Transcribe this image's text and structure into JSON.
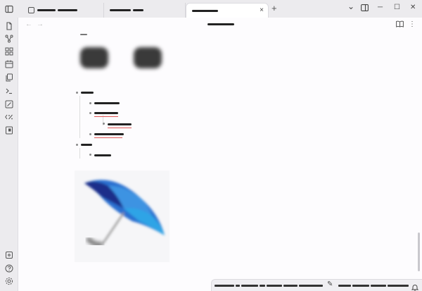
{
  "tabs": [
    {
      "label": "",
      "active": false,
      "close": ""
    },
    {
      "label": "",
      "active": false,
      "close": ""
    },
    {
      "label": "",
      "active": true,
      "close": "×"
    }
  ],
  "tabbar": {
    "new_tab": "+",
    "chevron": "⌄",
    "minimize": "─",
    "maximize": "☐",
    "close": "✕"
  },
  "ribbon": {
    "items": [
      "sidebar-toggle-icon",
      "files-icon",
      "graph-icon",
      "canvas-icon",
      "calendar-icon",
      "copy-icon",
      "terminal-icon",
      "sliders-icon",
      "code-percent-icon",
      "book-icon"
    ],
    "bottom": [
      "vault-icon",
      "help-icon",
      "settings-icon"
    ]
  },
  "nav": {
    "back": "←",
    "forward": "→"
  },
  "view": {
    "title": "",
    "reading": "📖",
    "more": "⋮"
  },
  "status": {
    "pencil": "✎",
    "bell": "🔔"
  },
  "colors": {
    "accent": "#1e73d8",
    "umbrella_dark": "#1b2f8a",
    "umbrella_light": "#2ea4e6",
    "squiggle": "#e05656"
  }
}
